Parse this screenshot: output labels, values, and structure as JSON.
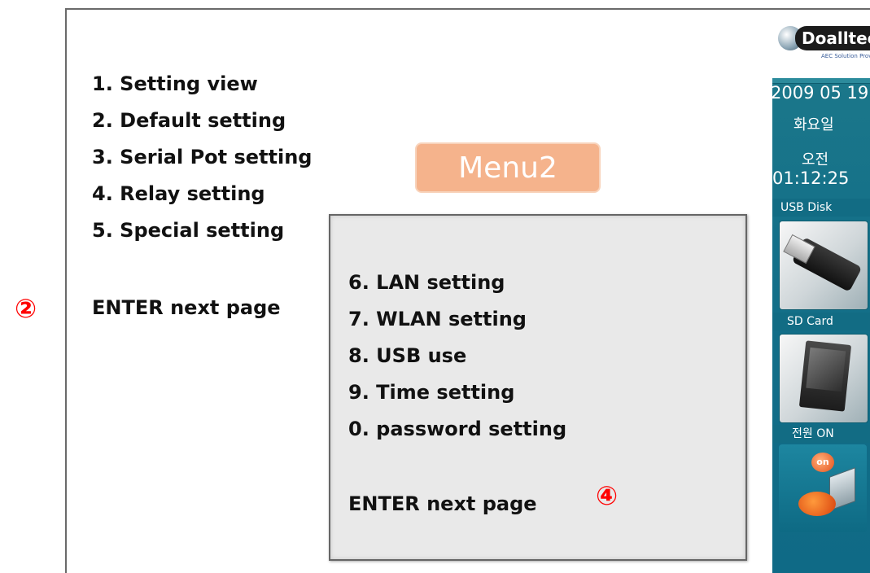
{
  "annotations": {
    "marker_left": "②",
    "marker_popup": "④"
  },
  "menu1": {
    "items": [
      {
        "label": "1. Setting view"
      },
      {
        "label": "2. Default setting"
      },
      {
        "label": "3. Serial Pot setting"
      },
      {
        "label": "4. Relay setting"
      },
      {
        "label": "5. Special setting"
      }
    ],
    "enter_label": "ENTER next page"
  },
  "title_badge": "Menu2",
  "menu2": {
    "items": [
      {
        "label": "6. LAN setting"
      },
      {
        "label": "7. WLAN setting"
      },
      {
        "label": "8. USB use"
      },
      {
        "label": "9. Time setting"
      },
      {
        "label": "0. password setting"
      }
    ],
    "enter_label": "ENTER next page"
  },
  "sidebar": {
    "logo_text": "Doalltech",
    "logo_sub": "AEC Solution Provider",
    "date": "2009 05 19",
    "weekday": "화요일",
    "ampm": "오전",
    "time": "01:12:25",
    "usb_label": "USB Disk",
    "sd_label": "SD Card",
    "power_label": "전원 ON",
    "power_badge": "on"
  },
  "colors": {
    "marker": "#ff0000",
    "badge_bg": "#f5b38c",
    "popup_bg": "#e9e9e9",
    "sidebar_bg": "#147089"
  }
}
